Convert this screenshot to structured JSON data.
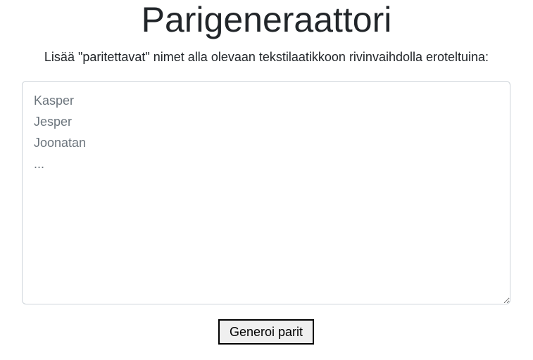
{
  "header": {
    "title": "Parigeneraattori",
    "instructions": "Lisää \"paritettavat\" nimet alla olevaan tekstilaatikkoon rivinvaihdolla eroteltuina:"
  },
  "names_input": {
    "value": "",
    "placeholder": "Kasper\nJesper\nJoonatan\n..."
  },
  "actions": {
    "generate_label": "Generoi parit"
  }
}
